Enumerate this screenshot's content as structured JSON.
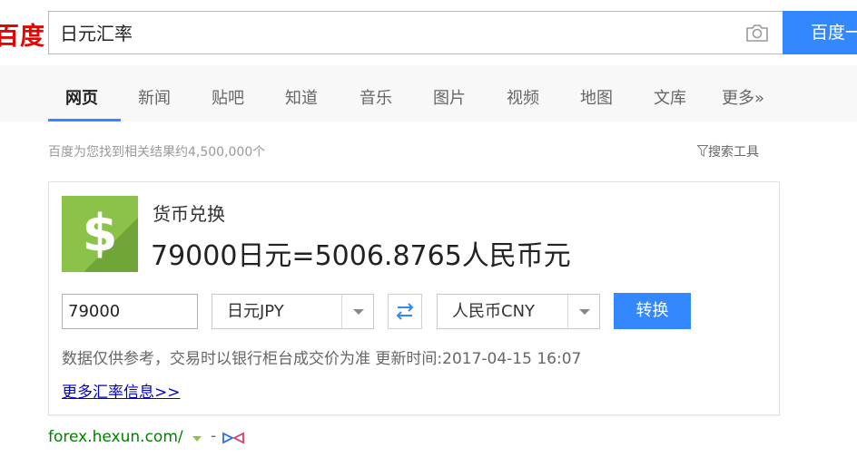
{
  "header": {
    "logo": "百度",
    "search_value": "日元汇率",
    "search_button": "百度一"
  },
  "nav": {
    "items": [
      "网页",
      "新闻",
      "贴吧",
      "知道",
      "音乐",
      "图片",
      "视频",
      "地图",
      "文库",
      "更多»"
    ],
    "active_index": 0
  },
  "results": {
    "count_text": "百度为您找到相关结果约4,500,000个",
    "tools_label": "搜索工具"
  },
  "converter": {
    "title": "货币兑换",
    "result": "79000日元=5006.8765人民币元",
    "amount": "79000",
    "from_currency": "日元JPY",
    "to_currency": "人民币CNY",
    "convert_label": "转换",
    "note": "数据仅供参考，交易时以银行柜台成交价为准 更新时间:2017-04-15 16:07",
    "more_link": "更多汇率信息>>",
    "icon_symbol": "$"
  },
  "source": {
    "url": "forex.hexun.com/",
    "dash": "-"
  },
  "colors": {
    "brand_red": "#e10601",
    "accent_blue": "#3388ff",
    "icon_green": "#8bc34a",
    "url_green": "#008000",
    "link_blue": "#0000cc"
  }
}
